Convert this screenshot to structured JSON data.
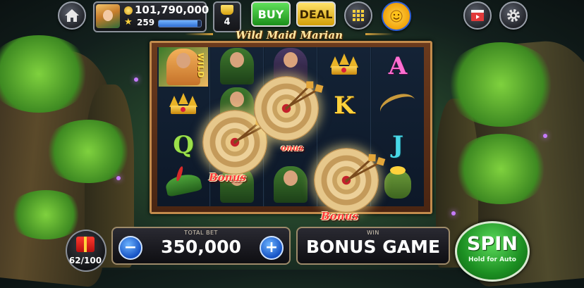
{
  "player": {
    "coins": "101,790,000",
    "level": "259",
    "xp_fraction": 0.92
  },
  "top_bar": {
    "trophy_count": "4",
    "buy_label": "BUY",
    "deal_label": "DEAL"
  },
  "game": {
    "title": "Wild Maid Marian"
  },
  "reels": {
    "wild_label": "WILD",
    "letters": {
      "a": "A",
      "k": "K",
      "q": "Q",
      "j": "J"
    },
    "bonus_label": "Bonus",
    "bonus_label_partial": "onus"
  },
  "bottom_bar": {
    "box_progress": "62/100",
    "total_bet_label": "TOTAL BET",
    "total_bet_value": "350,000",
    "minus_label": "−",
    "plus_label": "+",
    "win_label": "WIN",
    "win_value": "BONUS GAME",
    "spin_label": "SPIN",
    "spin_sub_label": "Hold for Auto"
  },
  "colors": {
    "buy": "#1b8f1a",
    "deal": "#d39e08",
    "spin": "#1c8f22",
    "bonus_text": "#ff3b3b"
  }
}
